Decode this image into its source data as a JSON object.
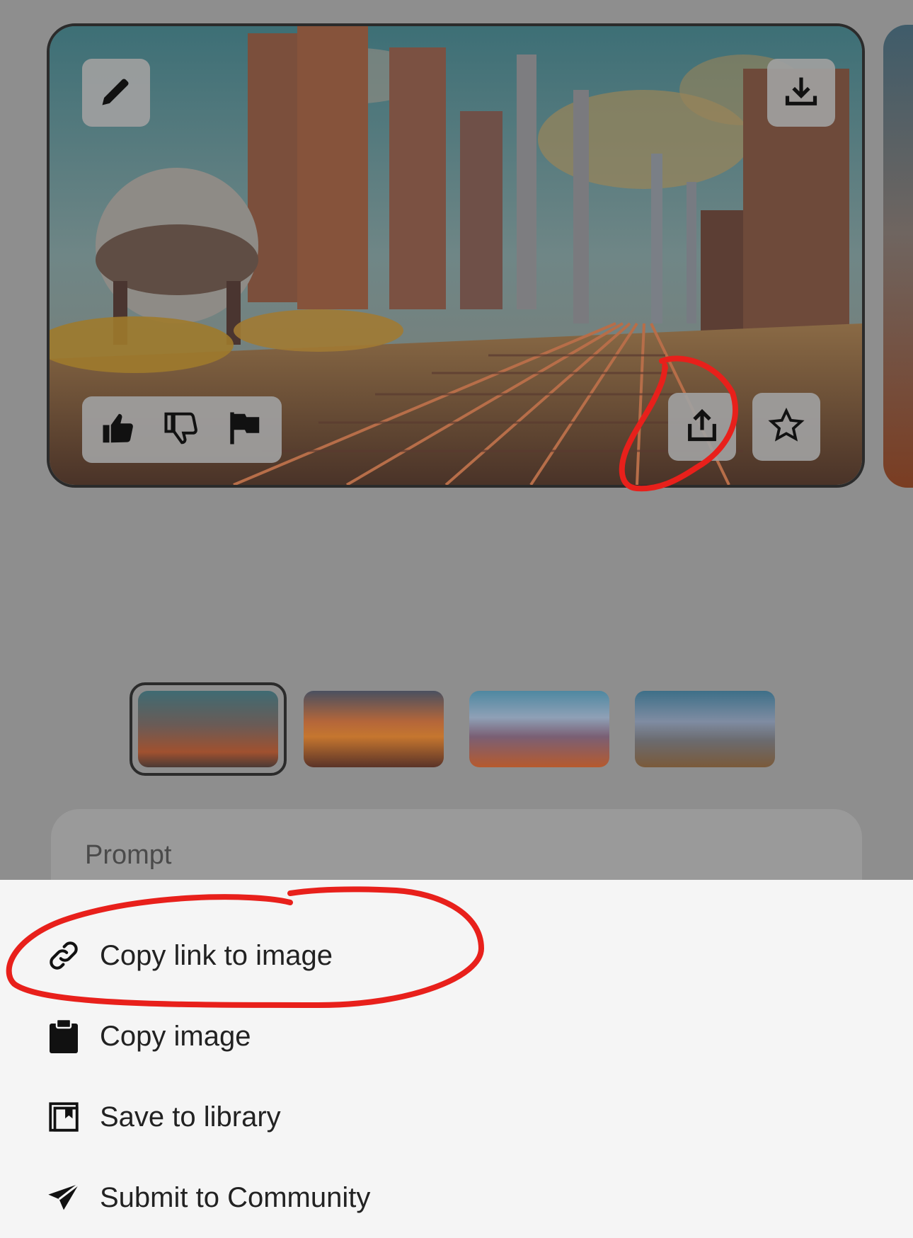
{
  "colors": {
    "overlay_dim": "#8f8f8f",
    "sheet_bg": "#f5f5f5",
    "annotation_red": "#e8201b",
    "text": "#222222"
  },
  "main_image": {
    "edit_icon": "pencil-icon",
    "download_icon": "download-icon",
    "thumbs_up_icon": "thumbs-up-icon",
    "thumbs_down_icon": "thumbs-down-icon",
    "flag_icon": "flag-icon",
    "share_icon": "share-icon",
    "favorite_icon": "star-icon"
  },
  "thumbnails": {
    "count": 4,
    "selected_index": 0
  },
  "prompt": {
    "label": "Prompt"
  },
  "share_menu": {
    "items": [
      {
        "label": "Copy link to image",
        "icon": "link-icon"
      },
      {
        "label": "Copy image",
        "icon": "clipboard-icon"
      },
      {
        "label": "Save to library",
        "icon": "library-icon"
      },
      {
        "label": "Submit to Community",
        "icon": "paper-plane-icon"
      }
    ]
  }
}
